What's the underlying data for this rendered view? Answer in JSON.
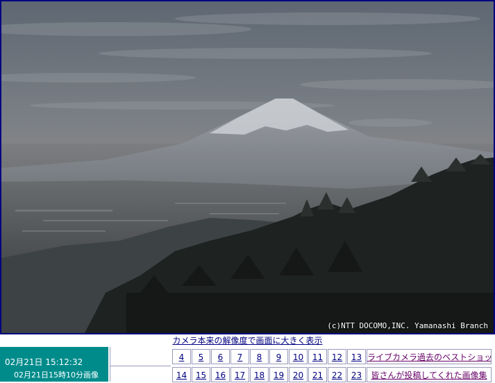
{
  "camera": {
    "copyright": "(c)NTT DOCOMO,INC. Yamanashi Branch"
  },
  "enlarge_link": "カメラ本来の解像度で画面に大きく表示",
  "time": {
    "current": "02月21日  15:12:32",
    "image": "02月21日15時10分画像"
  },
  "numbers_row1": [
    "4",
    "5",
    "6",
    "7",
    "8",
    "9",
    "10",
    "11",
    "12",
    "13"
  ],
  "numbers_row2": [
    "14",
    "15",
    "16",
    "17",
    "18",
    "19",
    "20",
    "21",
    "22",
    "23"
  ],
  "links": {
    "best_shots": "ライブカメラ過去のベストショット",
    "user_images": "皆さんが投稿してくれた画像集"
  },
  "colors": {
    "frame_border": "#000080",
    "time_bg": "#008b8b",
    "link": "#000080",
    "visited_link": "#660066"
  }
}
